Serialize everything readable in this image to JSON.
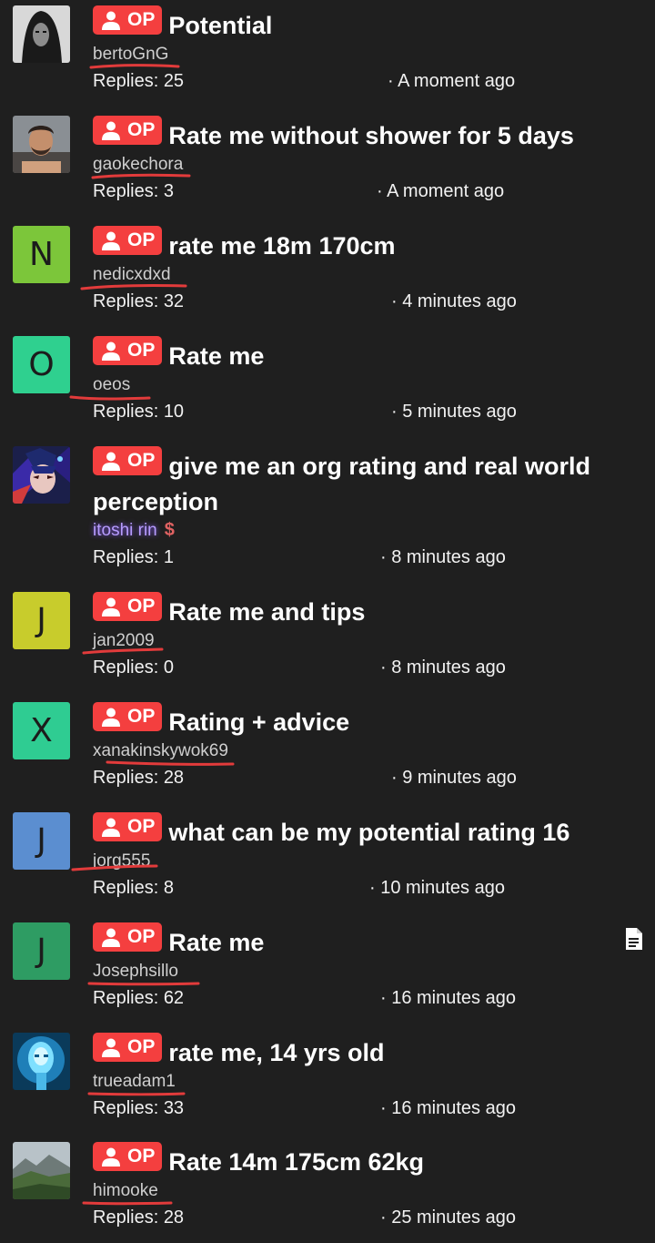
{
  "badge": {
    "label": "OP"
  },
  "threads": [
    {
      "title": "Potential",
      "author": "bertoGnG",
      "replies": "Replies: 25",
      "time": "· A moment ago",
      "avatar": {
        "kind": "image",
        "icon": "dark-portrait-avatar"
      }
    },
    {
      "title": "Rate me without shower for 5 days",
      "author": "gaokechora",
      "replies": "Replies: 3",
      "time": "· A moment ago",
      "avatar": {
        "kind": "image",
        "icon": "man-photo-avatar"
      }
    },
    {
      "title": "rate me 18m 170cm",
      "author": "nedicxdxd",
      "replies": "Replies: 32",
      "time": "· 4 minutes ago",
      "avatar": {
        "kind": "letter",
        "letter": "N",
        "color": "#7cc63a"
      }
    },
    {
      "title": "Rate me",
      "author": "oeos",
      "replies": "Replies: 10",
      "time": "· 5 minutes ago",
      "avatar": {
        "kind": "letter",
        "letter": "O",
        "color": "#2fd08f"
      }
    },
    {
      "title": "give me an org rating and real world perception",
      "author": "itoshi rin",
      "author_suffix": "$",
      "replies": "Replies: 1",
      "time": "· 8 minutes ago",
      "avatar": {
        "kind": "image",
        "icon": "anime-character-avatar"
      }
    },
    {
      "title": "Rate me and tips",
      "author": "jan2009",
      "replies": "Replies: 0",
      "time": "· 8 minutes ago",
      "avatar": {
        "kind": "letter",
        "letter": "J",
        "color": "#c8cc2c"
      }
    },
    {
      "title": "Rating + advice",
      "author": "xanakinskywok69",
      "replies": "Replies: 28",
      "time": "· 9 minutes ago",
      "avatar": {
        "kind": "letter",
        "letter": "X",
        "color": "#2fcc92"
      }
    },
    {
      "title": "what can be my potential rating 16",
      "author": "jorg555",
      "replies": "Replies: 8",
      "time": "· 10 minutes ago",
      "avatar": {
        "kind": "letter",
        "letter": "J",
        "color": "#5b8ed0"
      }
    },
    {
      "title": "Rate me",
      "author": "Josephsillo",
      "replies": "Replies: 62",
      "time": "· 16 minutes ago",
      "avatar": {
        "kind": "letter",
        "letter": "J",
        "color": "#2e9c63"
      }
    },
    {
      "title": "rate me, 14 yrs old",
      "author": "trueadam1",
      "replies": "Replies: 33",
      "time": "· 16 minutes ago",
      "avatar": {
        "kind": "image",
        "icon": "blue-glow-face-avatar"
      }
    },
    {
      "title": "Rate 14m 175cm 62kg",
      "author": "himooke",
      "replies": "Replies: 28",
      "time": "· 25 minutes ago",
      "avatar": {
        "kind": "image",
        "icon": "landscape-photo-avatar"
      }
    }
  ],
  "floating": {
    "icon": "document-icon"
  },
  "colors": {
    "background": "#1f1f1f",
    "badge": "#f43f3f",
    "scribble": "#e23b3b"
  }
}
